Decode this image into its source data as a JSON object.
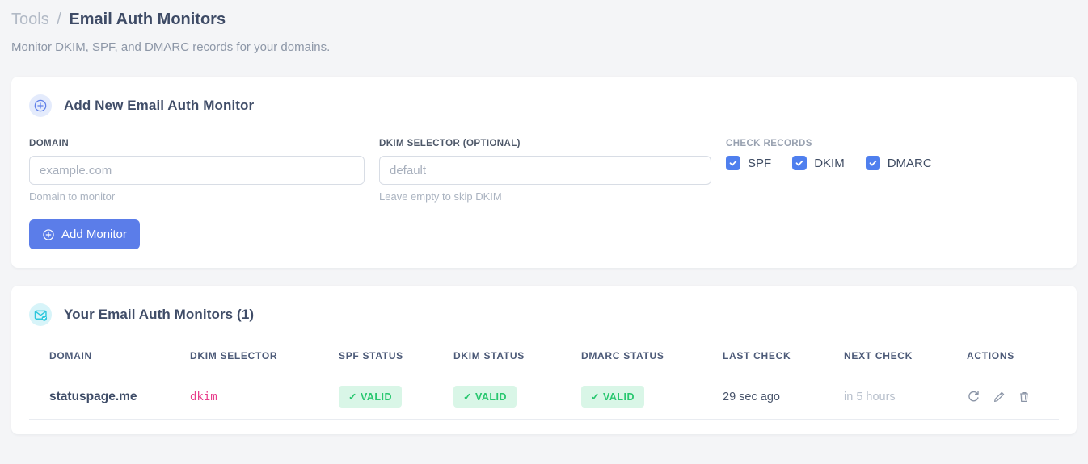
{
  "page": {
    "breadcrumb": {
      "parent": "Tools",
      "separator": "/",
      "current": "Email Auth Monitors"
    },
    "subtitle": "Monitor DKIM, SPF, and DMARC records for your domains."
  },
  "add_monitor": {
    "title": "Add New Email Auth Monitor",
    "header_icon": "plus-circle-icon",
    "fields": {
      "domain": {
        "label": "DOMAIN",
        "placeholder": "example.com",
        "value": "",
        "hint": "Domain to monitor"
      },
      "dkim_selector": {
        "label": "DKIM SELECTOR (OPTIONAL)",
        "placeholder": "default",
        "value": "",
        "hint": "Leave empty to skip DKIM"
      }
    },
    "check_records": {
      "label": "CHECK RECORDS",
      "options": [
        {
          "label": "SPF",
          "checked": true
        },
        {
          "label": "DKIM",
          "checked": true
        },
        {
          "label": "DMARC",
          "checked": true
        }
      ]
    },
    "submit_label": "Add Monitor"
  },
  "monitors": {
    "title": "Your Email Auth Monitors (1)",
    "header_icon": "email-check-icon",
    "table": {
      "headers": [
        "DOMAIN",
        "DKIM SELECTOR",
        "SPF STATUS",
        "DKIM STATUS",
        "DMARC STATUS",
        "LAST CHECK",
        "NEXT CHECK",
        "ACTIONS"
      ],
      "rows": [
        {
          "domain": "statuspage.me",
          "dkim_selector": "dkim",
          "spf_status": "✓ VALID",
          "dkim_status": "✓ VALID",
          "dmarc_status": "✓ VALID",
          "last_check": "29 sec ago",
          "next_check": "in 5 hours",
          "actions": [
            "refresh-icon",
            "edit-icon",
            "delete-icon"
          ]
        }
      ]
    }
  },
  "colors": {
    "accent_blue": "#5b7de9",
    "checkbox_blue": "#4f7fee",
    "badge_green_bg": "#d9f6e7",
    "badge_green_text": "#28c76f",
    "code_pink": "#e83e8c",
    "icon_circle_blue_bg": "#e4ebfc",
    "icon_circle_cyan_bg": "#d7f4f9",
    "icon_cyan": "#2ac7dc",
    "page_bg": "#f4f5f7"
  }
}
